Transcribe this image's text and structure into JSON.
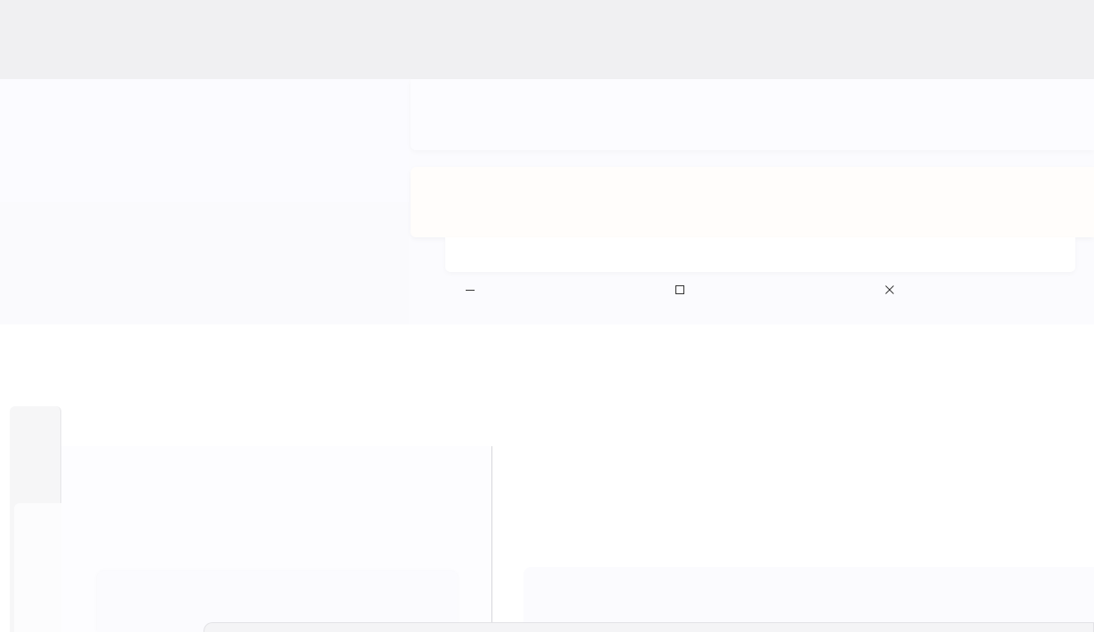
{
  "window_controls": {
    "minimize": {
      "icon": "minimize-icon"
    },
    "maximize": {
      "icon": "maximize-icon"
    },
    "close": {
      "icon": "close-icon"
    }
  },
  "colors": {
    "top_band": "#f0f0f2",
    "panel": "#fbfbfe",
    "icon_stroke": "#333333",
    "divider": "#d7d7db"
  }
}
